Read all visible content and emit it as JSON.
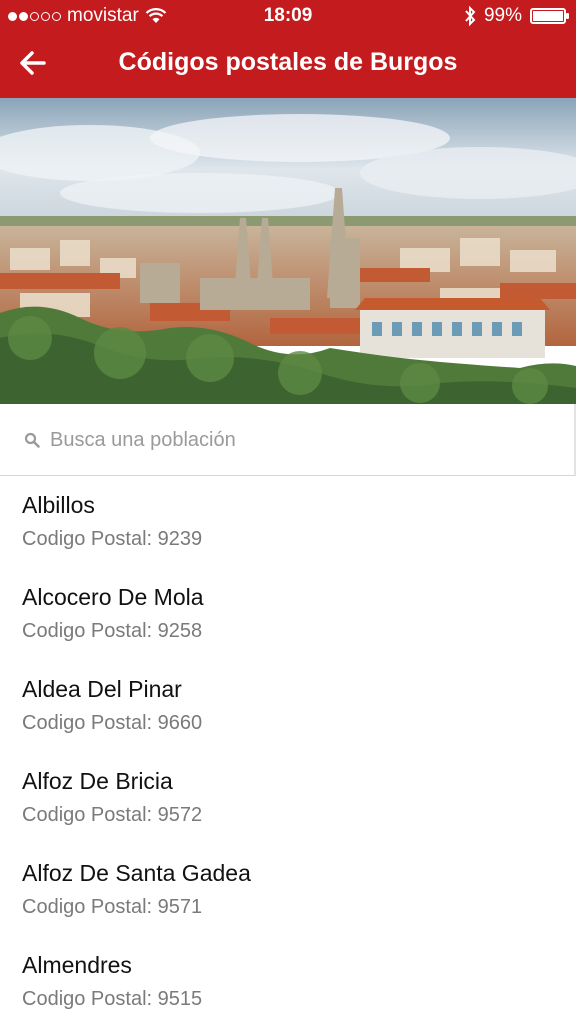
{
  "status_bar": {
    "carrier": "movistar",
    "time": "18:09",
    "battery": "99%",
    "battery_level": 0.99,
    "signal_bars_filled": 2,
    "signal_bars_total": 5
  },
  "header": {
    "title": "Códigos postales de Burgos",
    "back_icon": "arrow-left-icon",
    "background_color": "#c31b1e"
  },
  "search": {
    "placeholder": "Busca una población",
    "value": "",
    "icon": "search-icon"
  },
  "towns": [
    {
      "name": "Albillos",
      "postal": "Codigo Postal: 9239"
    },
    {
      "name": "Alcocero De Mola",
      "postal": "Codigo Postal: 9258"
    },
    {
      "name": "Aldea Del Pinar",
      "postal": "Codigo Postal: 9660"
    },
    {
      "name": "Alfoz De Bricia",
      "postal": "Codigo Postal: 9572"
    },
    {
      "name": "Alfoz De Santa Gadea",
      "postal": "Codigo Postal: 9571"
    },
    {
      "name": "Almendres",
      "postal": "Codigo Postal: 9515"
    }
  ]
}
